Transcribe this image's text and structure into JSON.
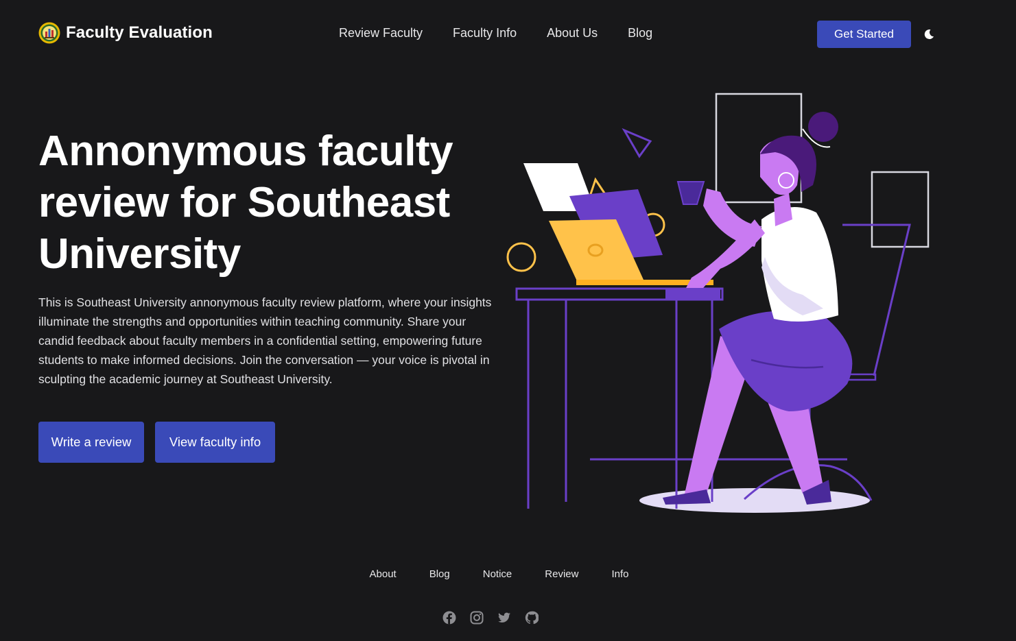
{
  "colors": {
    "background": "#18181a",
    "accent": "#3a4ab8",
    "illustration_purple": "#6a3fc8",
    "illustration_pink": "#c97af2",
    "illustration_yellow": "#ffc24a"
  },
  "brand": {
    "name": "Faculty Evaluation",
    "logo_icon": "university-seal-icon"
  },
  "nav": {
    "links": [
      "Review Faculty",
      "Faculty Info",
      "About Us",
      "Blog"
    ],
    "cta_label": "Get Started",
    "theme_toggle_icon": "moon-icon"
  },
  "hero": {
    "title": "Annonymous faculty review for Southeast University",
    "description": "This is Southeast University annonymous faculty review platform, where your insights illuminate the strengths and opportunities within teaching community. Share your candid feedback about faculty members in a confidential setting, empowering future students to make informed decisions. Join the conversation — your voice is pivotal in sculpting the academic journey at Southeast University.",
    "primary_button": "Write a review",
    "secondary_button": "View faculty info",
    "illustration_icon": "woman-at-laptop-illustration"
  },
  "footer": {
    "links": [
      "About",
      "Blog",
      "Notice",
      "Review",
      "Info"
    ],
    "social_icons": [
      "facebook-icon",
      "instagram-icon",
      "twitter-icon",
      "github-icon"
    ]
  }
}
